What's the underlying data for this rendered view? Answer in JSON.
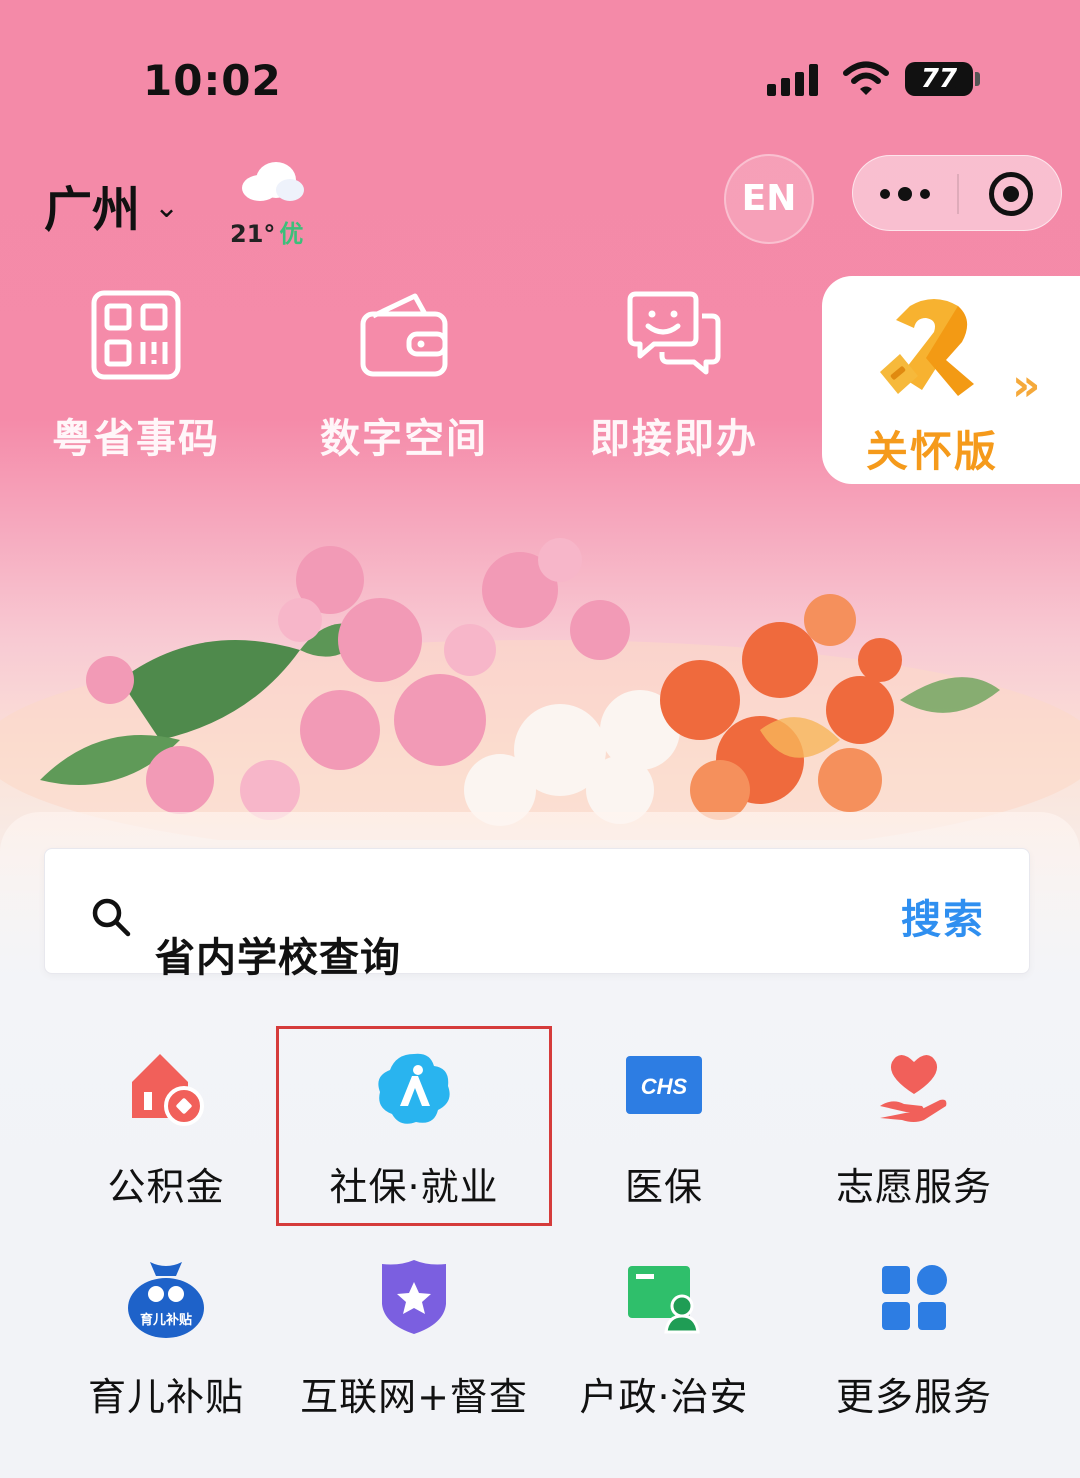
{
  "status_bar": {
    "time": "10:02",
    "battery": "77",
    "battery_level": 0.77
  },
  "header": {
    "city": "广州",
    "weather": {
      "temperature": "21°",
      "air_quality": "优"
    },
    "language_button": "EN"
  },
  "quick_actions": [
    {
      "label": "粤省事码",
      "icon": "qr-code-icon"
    },
    {
      "label": "数字空间",
      "icon": "wallet-icon"
    },
    {
      "label": "即接即办",
      "icon": "chat-bubbles-icon"
    }
  ],
  "care_mode": {
    "label": "关怀版",
    "icon": "care-ribbon-icon"
  },
  "search": {
    "placeholder": "省内学校查询",
    "button": "搜索"
  },
  "services": [
    {
      "label": "公积金",
      "icon": "house-fund-icon"
    },
    {
      "label": "社保·就业",
      "icon": "social-security-icon",
      "highlighted": true
    },
    {
      "label": "医保",
      "icon": "chs-medical-insurance-icon",
      "icon_text": "CHS"
    },
    {
      "label": "志愿服务",
      "icon": "heart-hand-icon"
    },
    {
      "label": "育儿补贴",
      "icon": "childcare-subsidy-icon",
      "icon_text": "育儿补贴"
    },
    {
      "label": "互联网+督查",
      "icon": "shield-star-icon"
    },
    {
      "label": "户政·治安",
      "icon": "id-card-icon"
    },
    {
      "label": "更多服务",
      "icon": "grid-more-icon"
    }
  ],
  "colors": {
    "header_pink": "#f48aa8",
    "care_orange": "#f59a1b",
    "search_blue": "#2f8ff0",
    "highlight_red": "#d53b3b"
  }
}
